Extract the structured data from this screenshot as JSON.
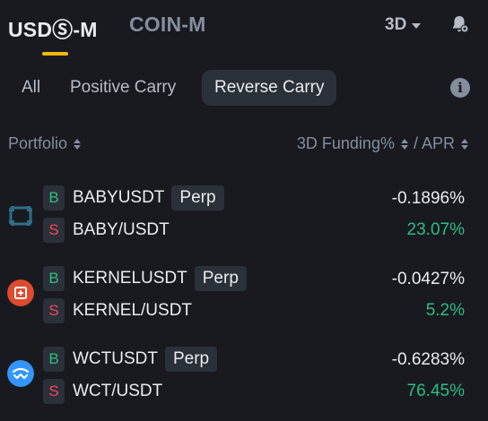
{
  "tabs": {
    "primary_active": "USDⓈ-M",
    "primary_inactive": "COIN-M",
    "period": "3D"
  },
  "filters": {
    "all": "All",
    "positive": "Positive Carry",
    "reverse": "Reverse Carry",
    "selected": "Reverse Carry"
  },
  "header": {
    "portfolio": "Portfolio",
    "funding": "3D Funding%",
    "apr": "/ APR"
  },
  "colors": {
    "accent": "#f0b90b",
    "buy": "#2ebd85",
    "sell": "#f6465d"
  },
  "rows": [
    {
      "icon": "babylon-icon",
      "buy_label": "B",
      "perp_symbol": "BABYUSDT",
      "perp_tag": "Perp",
      "sell_label": "S",
      "spot_symbol": "BABY/USDT",
      "funding": "-0.1896%",
      "apr": "23.07%"
    },
    {
      "icon": "kernel-icon",
      "buy_label": "B",
      "perp_symbol": "KERNELUSDT",
      "perp_tag": "Perp",
      "sell_label": "S",
      "spot_symbol": "KERNEL/USDT",
      "funding": "-0.0427%",
      "apr": "5.2%"
    },
    {
      "icon": "walletconnect-icon",
      "buy_label": "B",
      "perp_symbol": "WCTUSDT",
      "perp_tag": "Perp",
      "sell_label": "S",
      "spot_symbol": "WCT/USDT",
      "funding": "-0.6283%",
      "apr": "76.45%"
    }
  ]
}
